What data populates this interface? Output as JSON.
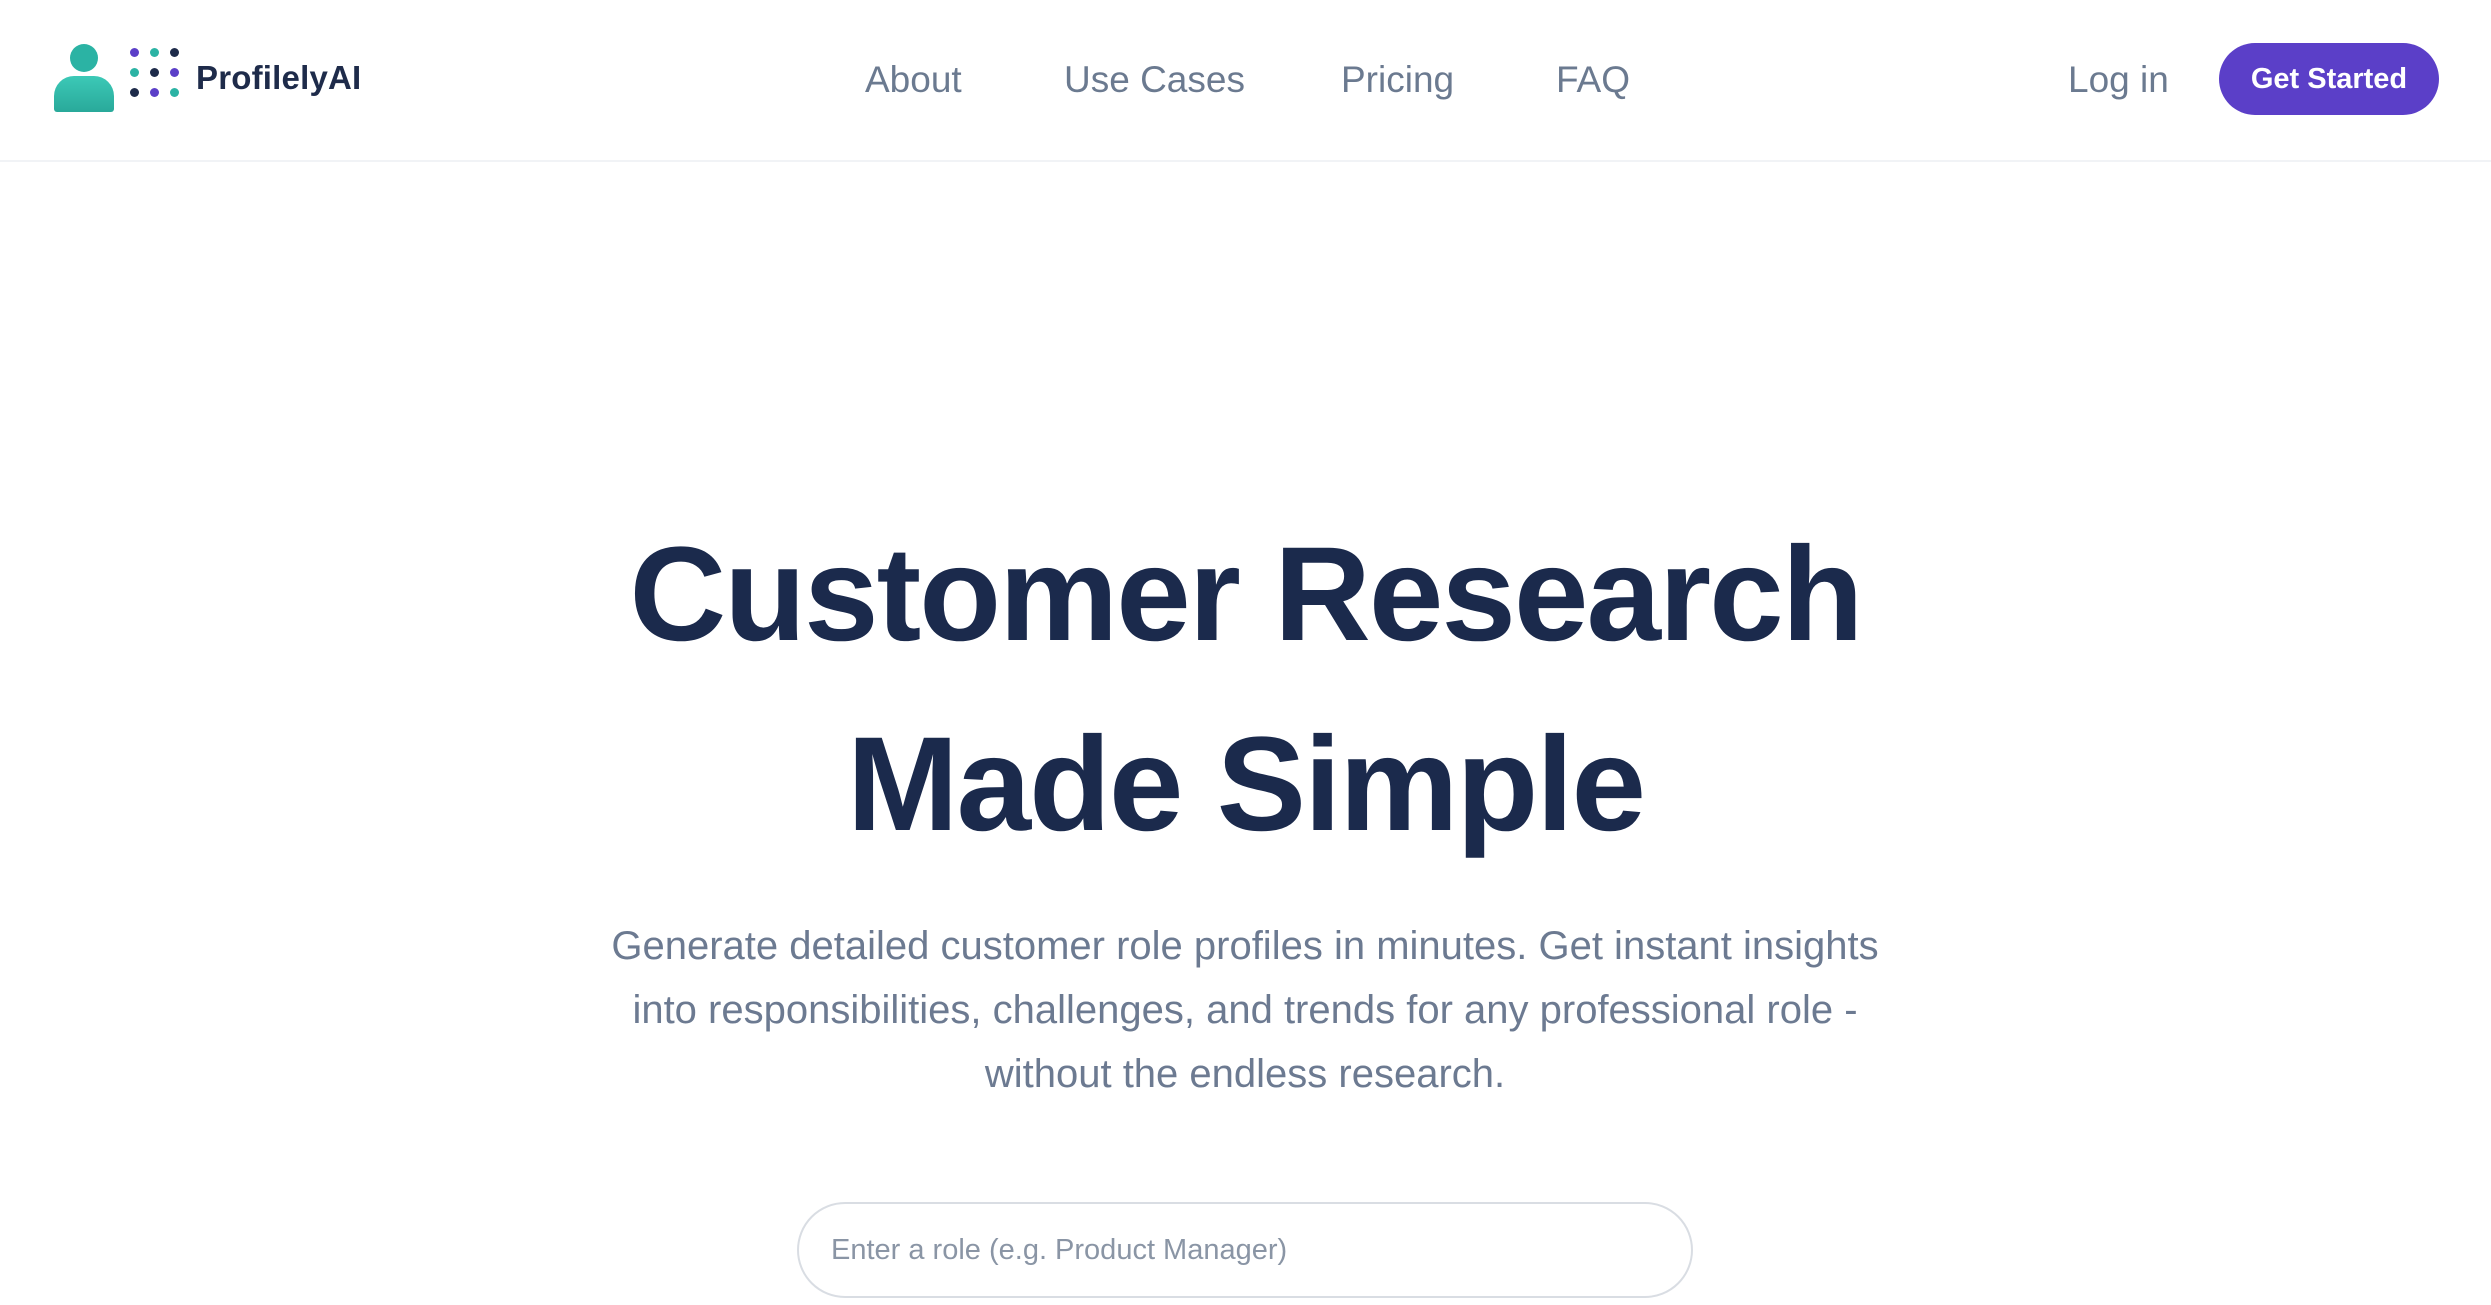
{
  "brand": {
    "name": "ProfilelyAI",
    "colors": {
      "teal": "#2bb3a4",
      "purple": "#5b3fc8",
      "navy": "#1e2b4a"
    }
  },
  "nav": {
    "items": [
      {
        "label": "About"
      },
      {
        "label": "Use Cases"
      },
      {
        "label": "Pricing"
      },
      {
        "label": "FAQ"
      }
    ],
    "login_label": "Log in",
    "cta_label": "Get Started"
  },
  "hero": {
    "title_line1": "Customer Research",
    "title_line2": "Made Simple",
    "subtitle": "Generate detailed customer role profiles in minutes. Get instant insights into responsibilities, challenges, and trends for any professional role - without the endless research.",
    "search_placeholder": "Enter a role (e.g. Product Manager)",
    "search_value": ""
  }
}
